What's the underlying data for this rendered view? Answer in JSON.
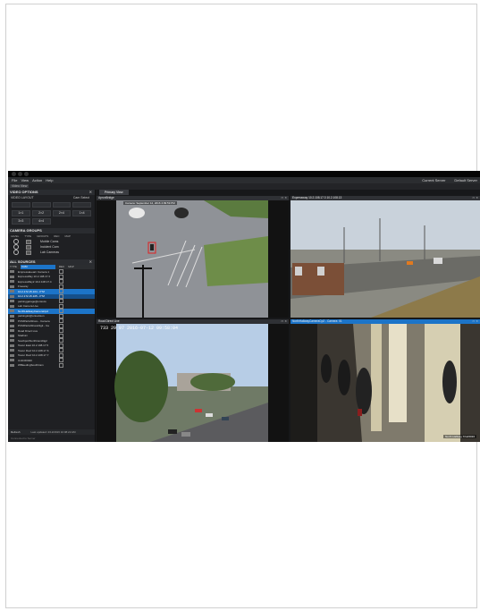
{
  "menu": {
    "items": [
      "File",
      "View",
      "Action",
      "Help"
    ],
    "right_items": [
      "Current Server",
      "Default Server"
    ]
  },
  "toolbar": {
    "tag": "Video View"
  },
  "video_options": {
    "title": "VIDEO OPTIONS",
    "layout_label": "VIDEO LAYOUT",
    "cam_select": "Cam Select",
    "layout_buttons": [
      "1×1",
      "2×2",
      "2×4",
      "1×4",
      "3×3",
      "4×4"
    ],
    "camera_groups_title": "CAMERA GROUPS",
    "group_columns": [
      "LEVEL",
      "TYPE",
      "GROUPS",
      "REC",
      "MAP"
    ],
    "groups": [
      "Mobile Cams",
      "Incident Cam",
      "Lab Cameras"
    ]
  },
  "all_sources": {
    "title": "ALL SOURCES",
    "columns": [
      "TYPE",
      "CAM",
      "REC",
      "MAP"
    ],
    "rows": [
      "EmpressaLearn Camera 1",
      "ExpressWay 10.2.108.17.3",
      "ExpressWay2 10.2.108.17.4",
      "Freeway",
      "10.2.172.15.104 - PTZ",
      "10.2.172.15.105 - PTZ",
      "parkinggarage@ontovis",
      "Lab Camera Live",
      "NorthHallwayCameraCp2",
      "parkinglot@ontovision",
      "PCMParksShore - Camera",
      "PCMParksShoreDigit - Ca",
      "Road Direct Live",
      "Stadium",
      "SouthportNorthCamDig2",
      "Tower East 10.2.108.17.5",
      "Tower Roof 10.2.108.17.6",
      "Tower Roof 10.2.108.17.7",
      "UnitC60020",
      "WBleedingSouthCam"
    ],
    "selected_rows": [
      4,
      8
    ],
    "highlight_rows": [
      5
    ]
  },
  "footer": {
    "refresh": "Refresh",
    "updated": "Last updated: 2/12/2016 10:08:22 AM",
    "status": "Connected to Server"
  },
  "tabs": [
    "Primary View"
  ],
  "panes": [
    {
      "title": "ApronBridge",
      "overlay": "Camera: September 12, 2016 4:09:59 PM",
      "active": false
    },
    {
      "title": "Expressway 10.2.108.17.3 10.2.108.13",
      "overlay": "",
      "active": false
    },
    {
      "title": "Road Direct Live",
      "overlay": "733 29 97 2016-07-12 09:58:04",
      "active": false
    },
    {
      "title": "NorthHallwayCameraCp2 - Camera: 01",
      "overlay": "North Hallway  7/12/2016",
      "active": true
    }
  ]
}
